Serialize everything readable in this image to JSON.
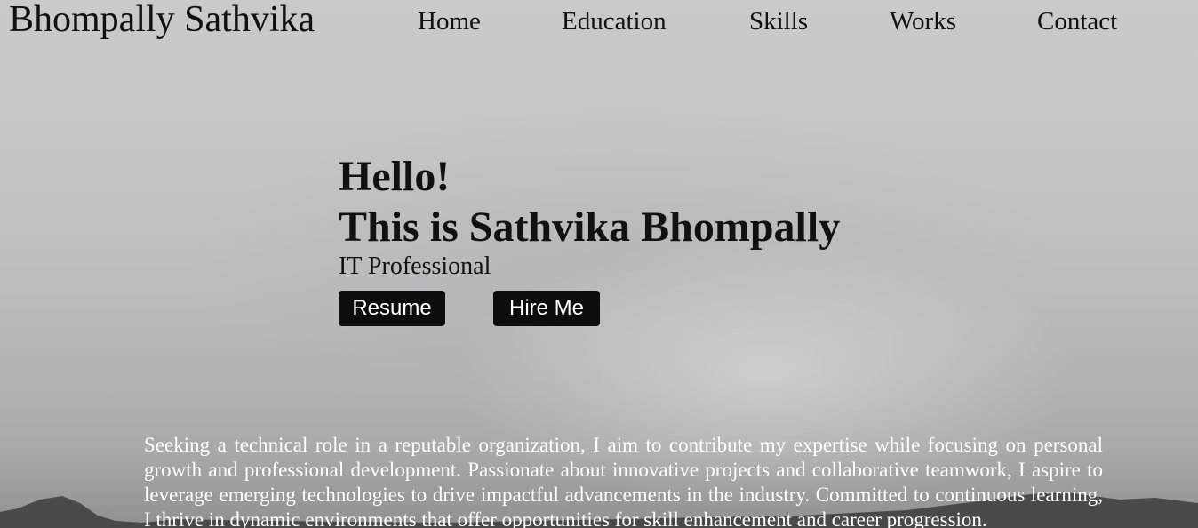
{
  "header": {
    "brand": "Bhompally Sathvika",
    "nav": [
      {
        "label": "Home"
      },
      {
        "label": "Education"
      },
      {
        "label": "Skills"
      },
      {
        "label": "Works"
      },
      {
        "label": "Contact"
      }
    ]
  },
  "hero": {
    "greeting": "Hello!",
    "intro": "This is Sathvika Bhompally",
    "role": "IT Professional",
    "resume_label": "Resume",
    "hire_label": "Hire Me"
  },
  "about": {
    "text": "Seeking a technical role in a reputable organization, I aim to contribute my expertise while focusing on personal growth and professional development. Passionate about innovative projects and collaborative teamwork, I aspire to leverage emerging technologies to drive impactful advancements in the industry. Committed to continuous learning, I thrive in dynamic environments that offer opportunities for skill enhancement and career progression."
  },
  "colors": {
    "button_bg": "#0d0d0d",
    "button_text": "#ffffff",
    "text_dark": "#111111",
    "text_light": "#ffffff"
  }
}
